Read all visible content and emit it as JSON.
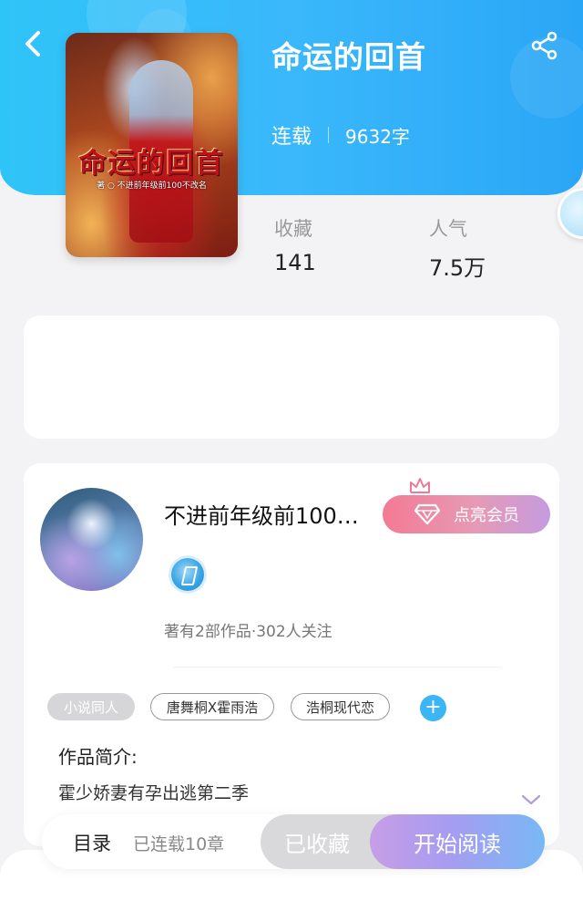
{
  "header": {
    "title": "命运的回首",
    "status": "连载",
    "word_count": "9632字",
    "back_icon": "chevron-left-icon",
    "share_icon": "share-icon",
    "accent_color": "#33b8f8"
  },
  "cover": {
    "title_text": "命运的回首",
    "subtitle_text": "著 ○ 不进前年级前100不改名"
  },
  "stats": {
    "collect_label": "收藏",
    "collect_value": "141",
    "popularity_label": "人气",
    "popularity_value": "7.5万"
  },
  "author": {
    "name": "不进前年级前100…",
    "vip_button_label": "点亮会员",
    "works_summary": "著有2部作品·302人关注"
  },
  "tags": [
    "小说同人",
    "唐舞桐X霍雨浩",
    "浩桐现代恋"
  ],
  "intro": {
    "label": "作品简介:",
    "text": "霍少娇妻有孕出逃第二季"
  },
  "bottom_bar": {
    "toc_label": "目录",
    "toc_sub": "已连载10章",
    "collect_button": "已收藏",
    "read_button": "开始阅读"
  }
}
